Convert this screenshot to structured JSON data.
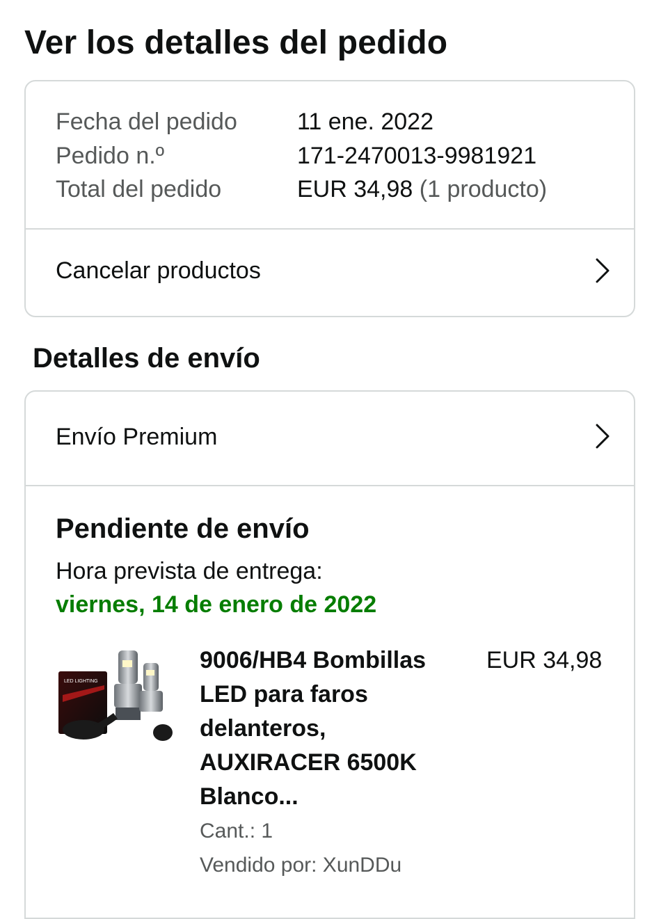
{
  "page": {
    "title": "Ver los detalles del pedido"
  },
  "order_summary": {
    "date_label": "Fecha del pedido",
    "date_value": "11 ene. 2022",
    "number_label": "Pedido n.º",
    "number_value": "171-2470013-9981921",
    "total_label": "Total del pedido",
    "total_value": "EUR 34,98",
    "total_count": "(1 producto)",
    "cancel_label": "Cancelar productos"
  },
  "shipping": {
    "section_title": "Detalles de envío",
    "method_label": "Envío Premium",
    "status": "Pendiente de envío",
    "eta_label": "Hora prevista de entrega:",
    "eta_date": "viernes, 14 de enero de 2022",
    "accent_color": "#067d00"
  },
  "product": {
    "title": "9006/HB4 Bombillas LED para faros delanteros, AUXIRACER 6500K Blanco...",
    "price": "EUR 34,98",
    "quantity": "Cant.: 1",
    "seller": "Vendido por: XunDDu",
    "image_logo_text": "LED LIGHTING"
  }
}
